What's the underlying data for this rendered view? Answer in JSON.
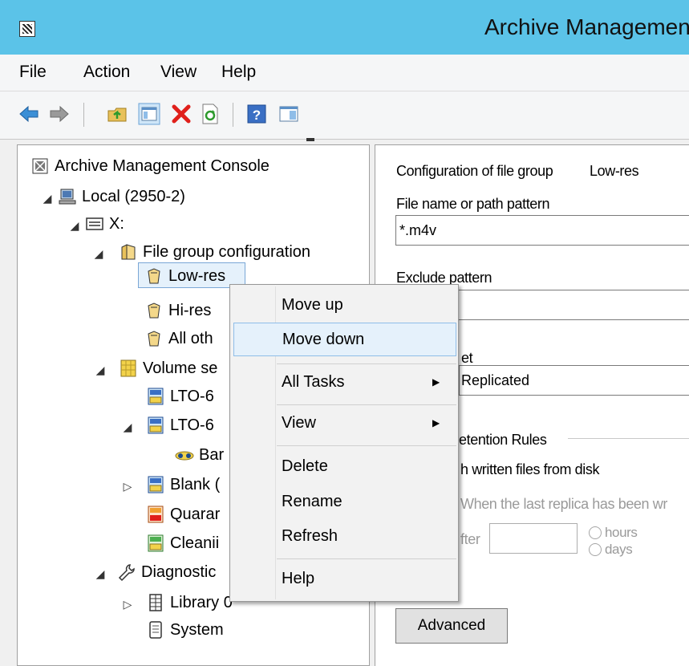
{
  "window": {
    "title": "Archive Management"
  },
  "menubar": {
    "items": [
      "File",
      "Action",
      "View",
      "Help"
    ]
  },
  "toolbar": {
    "buttons": [
      "back-arrow-icon",
      "forward-arrow-icon",
      "up-folder-icon",
      "show-hide-tree-icon",
      "delete-icon",
      "refresh-icon",
      "help-icon",
      "action-pane-icon"
    ]
  },
  "tree": {
    "root": "Archive Management Console",
    "local": "Local (2950-2)",
    "drive": "X:",
    "file_group_config": "File group configuration",
    "low_res": "Low-res",
    "hi_res": "Hi-res",
    "all_other": "All oth",
    "volume_sets": "Volume se",
    "lto6_a": "LTO-6",
    "lto6_b": "LTO-6",
    "barcode": "Bar",
    "blank": "Blank (",
    "quarantine": "Quarar",
    "cleaning": "Cleanii",
    "diagnostics": "Diagnostic",
    "library": "Library 0",
    "system": "System"
  },
  "details": {
    "config_label": "Configuration of file group",
    "config_value": "Low-res",
    "pattern_label": "File name or path pattern",
    "pattern_value": "*.m4v",
    "exclude_label": "Exclude pattern",
    "exclude_value": "",
    "set_label": "et",
    "set_value": "Replicated",
    "retention_label": "etention Rules",
    "delete_label": "h written files from disk",
    "when_label": "When the last replica has been wr",
    "after_label": "fter",
    "after_value": "",
    "hours_label": "hours",
    "days_label": "days",
    "advanced_button": "Advanced"
  },
  "context_menu": {
    "move_up": "Move up",
    "move_down": "Move down",
    "all_tasks": "All Tasks",
    "view": "View",
    "delete": "Delete",
    "rename": "Rename",
    "refresh": "Refresh",
    "help": "Help"
  },
  "colors": {
    "titlebar": "#5bc3e8",
    "selection": "#e5f1fb",
    "selection_border": "#8fbde8",
    "delete_red": "#e0201b"
  }
}
